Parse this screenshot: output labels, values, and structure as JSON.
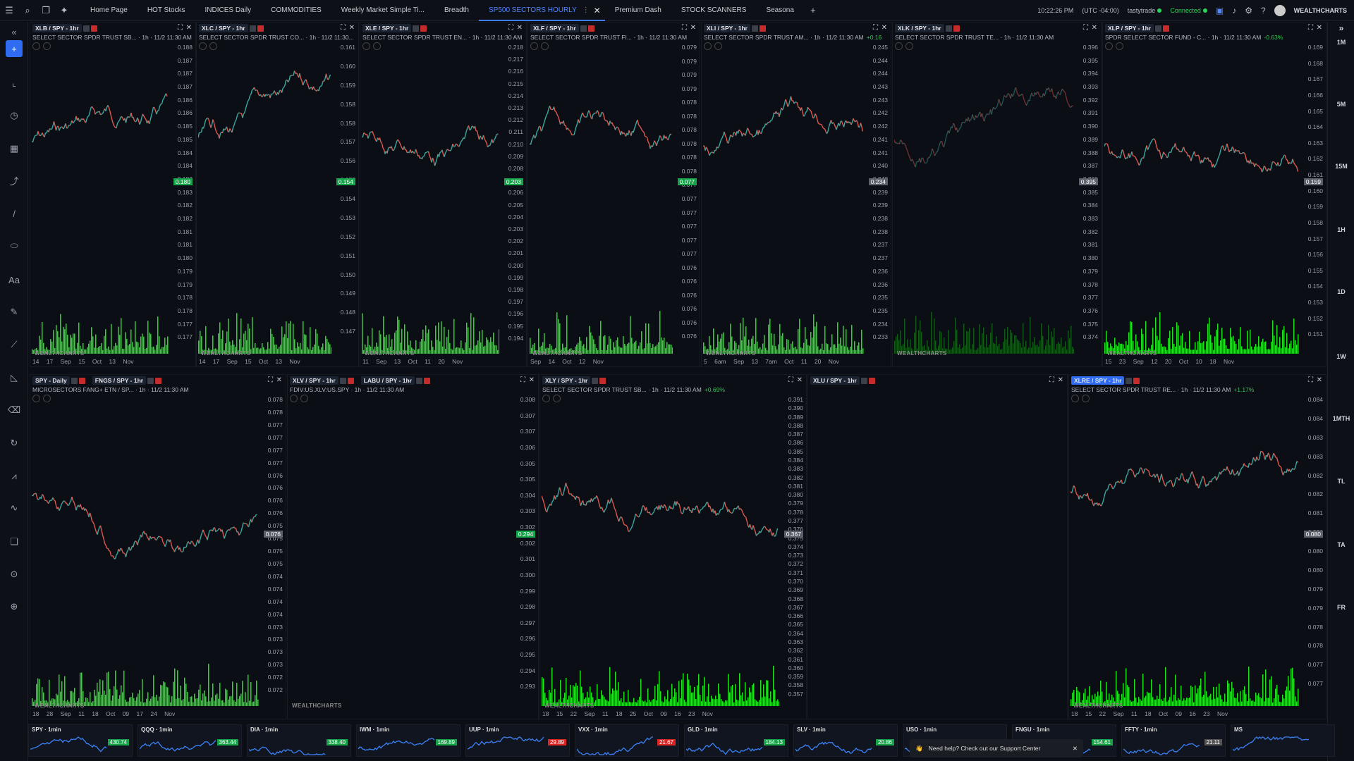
{
  "topbar": {
    "tabs": [
      "Home Page",
      "HOT Stocks",
      "INDICES Daily",
      "COMMODITIES",
      "Weekly Market Simple Ti...",
      "Breadth",
      "SP500 SECTORS HOURLY",
      "Premium Dash",
      "STOCK SCANNERS",
      "Seasona"
    ],
    "active_tab": "SP500 SECTORS HOURLY",
    "clock": "10:22:26 PM",
    "timezone": "(UTC -04:00)",
    "broker": "tastytrade",
    "status": "Connected",
    "brand": "WEALTHCHARTS"
  },
  "right_intervals": [
    "1M",
    "5M",
    "15M",
    "1H",
    "1D",
    "1W",
    "1MTH",
    "TL",
    "TA",
    "FR"
  ],
  "panels": [
    {
      "symbol": "XLB / SPY - 1hr",
      "desc": "SELECT SECTOR SPDR TRUST SB... · 1h · 11/2 11:30 AM",
      "change": "",
      "price": "0.180",
      "price_color": "green",
      "ticks": [
        "0.188",
        "0.187",
        "0.187",
        "0.187",
        "0.186",
        "0.186",
        "0.185",
        "0.185",
        "0.184",
        "0.184",
        "0.183",
        "0.183",
        "0.182",
        "0.182",
        "0.181",
        "0.181",
        "0.180",
        "0.179",
        "0.179",
        "0.178",
        "0.178",
        "0.177",
        "0.177"
      ],
      "xaxis": "14 17 Sep 15 Oct 13 Nov",
      "color": "#ef5350"
    },
    {
      "symbol": "XLC / SPY - 1hr",
      "desc": "SELECT SECTOR SPDR TRUST CO... · 1h · 11/2 11:30...",
      "change": "",
      "price": "0.154",
      "price_color": "green",
      "ticks": [
        "0.161",
        "0.160",
        "0.159",
        "0.158",
        "0.158",
        "0.157",
        "0.156",
        "0.155",
        "0.154",
        "0.153",
        "0.152",
        "0.151",
        "0.150",
        "0.149",
        "0.148",
        "0.147"
      ],
      "xaxis": "14 17 Sep 15 Oct 13 Nov",
      "color": "#ef5350"
    },
    {
      "symbol": "XLE / SPY - 1hr",
      "desc": "SELECT SECTOR SPDR TRUST EN... · 1h · 11/2 11:30 AM",
      "change": "",
      "price": "0.203",
      "price_color": "green",
      "ticks": [
        "0.218",
        "0.217",
        "0.216",
        "0.215",
        "0.214",
        "0.213",
        "0.212",
        "0.211",
        "0.210",
        "0.209",
        "0.208",
        "0.207",
        "0.206",
        "0.205",
        "0.204",
        "0.203",
        "0.202",
        "0.201",
        "0.200",
        "0.199",
        "0.198",
        "0.197",
        "0.196",
        "0.195",
        "0.194"
      ],
      "xaxis": "11 Sep 13 Oct 11 20 Nov",
      "color": "#ef5350"
    },
    {
      "symbol": "XLF / SPY - 1hr",
      "desc": "SELECT SECTOR SPDR TRUST FI... · 1h · 11/2 11:30 AM",
      "change": "",
      "price": "0.077",
      "price_color": "green",
      "ticks": [
        "0.079",
        "0.079",
        "0.079",
        "0.079",
        "0.078",
        "0.078",
        "0.078",
        "0.078",
        "0.078",
        "0.078",
        "0.077",
        "0.077",
        "0.077",
        "0.077",
        "0.077",
        "0.077",
        "0.076",
        "0.076",
        "0.076",
        "0.076",
        "0.076",
        "0.076"
      ],
      "xaxis": "Sep 14 Oct 12 Nov",
      "color": "#ef5350"
    },
    {
      "symbol": "XLI / SPY - 1hr",
      "desc": "SELECT SECTOR SPDR TRUST AM... · 1h · 11/2 11:30 AM",
      "change": "+0.16",
      "price": "0.234",
      "price_color": "gray",
      "ticks": [
        "0.245",
        "0.244",
        "0.244",
        "0.243",
        "0.243",
        "0.242",
        "0.242",
        "0.241",
        "0.241",
        "0.240",
        "0.240",
        "0.239",
        "0.239",
        "0.238",
        "0.238",
        "0.237",
        "0.237",
        "0.236",
        "0.236",
        "0.235",
        "0.235",
        "0.234",
        "0.233"
      ],
      "xaxis": "5 6am Sep 13 7am Oct 11 20 Nov",
      "color": "#ef5350"
    },
    {
      "symbol": "XLK / SPY - 1hr",
      "desc": "SELECT SECTOR SPDR TRUST TE... · 1h · 11/2 11:30 AM",
      "change": "",
      "price": "0.395",
      "price_color": "gray",
      "ticks": [
        "0.396",
        "0.395",
        "0.394",
        "0.393",
        "0.392",
        "0.391",
        "0.390",
        "0.389",
        "0.388",
        "0.387",
        "0.386",
        "0.385",
        "0.384",
        "0.383",
        "0.382",
        "0.381",
        "0.380",
        "0.379",
        "0.378",
        "0.377",
        "0.376",
        "0.375",
        "0.374"
      ],
      "xaxis": "",
      "color": "#ef5350"
    },
    {
      "symbol": "XLP / SPY - 1hr",
      "desc": "SPDR SELECT SECTOR FUND - C... · 1h · 11/2 11:30 AM",
      "change": "-0.63%",
      "price": "0.159",
      "price_color": "gray",
      "ticks": [
        "0.169",
        "0.168",
        "0.167",
        "0.166",
        "0.165",
        "0.164",
        "0.163",
        "0.162",
        "0.161",
        "0.160",
        "0.159",
        "0.158",
        "0.157",
        "0.156",
        "0.155",
        "0.154",
        "0.153",
        "0.152",
        "0.151"
      ],
      "xaxis": "15 23 Sep 12 20 Oct 10 18 Nov",
      "color": "#ef5350"
    },
    {
      "symbol": "SPY - Daily",
      "symbol2": "FNGS / SPY - 1hr",
      "desc": "MICROSECTORS FANG+ ETN / SP... · 1h · 11/2 11:30 AM",
      "change": "",
      "price": "0.076",
      "price_color": "gray",
      "ticks": [
        "0.078",
        "0.078",
        "0.077",
        "0.077",
        "0.077",
        "0.077",
        "0.076",
        "0.076",
        "0.076",
        "0.076",
        "0.075",
        "0.075",
        "0.075",
        "0.075",
        "0.074",
        "0.074",
        "0.074",
        "0.074",
        "0.073",
        "0.073",
        "0.073",
        "0.073",
        "0.072",
        "0.072"
      ],
      "xaxis": "18 28 Sep 11 18 Oct 09 17 24 Nov",
      "color": "#ef5350"
    },
    {
      "symbol": "XLV / SPY - 1hr",
      "symbol2": "LABU / SPY - 1hr",
      "desc": "FDIV:US.XLV:US.SPY · 1h · 11/2 11:30 AM",
      "change": "",
      "price": "0.294",
      "price_color": "green",
      "ticks": [
        "0.308",
        "0.307",
        "0.307",
        "0.306",
        "0.305",
        "0.305",
        "0.304",
        "0.303",
        "0.302",
        "0.302",
        "0.301",
        "0.300",
        "0.299",
        "0.298",
        "0.297",
        "0.296",
        "0.295",
        "0.294",
        "0.293"
      ],
      "xaxis": "",
      "color": "#ef5350"
    },
    {
      "symbol": "XLY / SPY - 1hr",
      "desc": "SELECT SECTOR SPDR TRUST SB... · 1h · 11/2 11:30 AM",
      "change": "+0.69%",
      "price": "0.367",
      "price_color": "gray",
      "ticks": [
        "0.391",
        "0.390",
        "0.389",
        "0.388",
        "0.387",
        "0.386",
        "0.385",
        "0.384",
        "0.383",
        "0.382",
        "0.381",
        "0.380",
        "0.379",
        "0.378",
        "0.377",
        "0.376",
        "0.375",
        "0.374",
        "0.373",
        "0.372",
        "0.371",
        "0.370",
        "0.369",
        "0.368",
        "0.367",
        "0.366",
        "0.365",
        "0.364",
        "0.363",
        "0.362",
        "0.361",
        "0.360",
        "0.359",
        "0.358",
        "0.357"
      ],
      "xaxis": "18 15 22 Sep 11 18 25 Oct 09 16 23 Nov",
      "color": "#ef5350"
    },
    {
      "symbol": "XLU / SPY - 1hr",
      "desc": "",
      "change": "",
      "price": "",
      "price_color": "gray",
      "ticks": [],
      "xaxis": "",
      "color": "#ef5350"
    },
    {
      "symbol": "XLRE / SPY - 1hr",
      "desc": "SELECT SECTOR SPDR TRUST RE... · 1h · 11/2 11:30 AM",
      "change": "+1.17%",
      "price": "0.080",
      "price_color": "gray",
      "ticks": [
        "0.084",
        "0.084",
        "0.083",
        "0.083",
        "0.082",
        "0.082",
        "0.081",
        "0.081",
        "0.080",
        "0.080",
        "0.079",
        "0.079",
        "0.078",
        "0.078",
        "0.077",
        "0.077"
      ],
      "xaxis": "18 15 22 Sep 11 18 Oct 09 16 23 Nov",
      "color": "#ef5350"
    }
  ],
  "watermark": "WEALTHCHARTS",
  "minis": [
    {
      "label": "SPY · 1min",
      "value": "430.74",
      "color": "green"
    },
    {
      "label": "QQQ · 1min",
      "value": "363.44",
      "color": "green"
    },
    {
      "label": "DIA · 1min",
      "value": "338.40",
      "color": "green"
    },
    {
      "label": "IWM · 1min",
      "value": "169.89",
      "color": "green"
    },
    {
      "label": "UUP · 1min",
      "value": "29.89",
      "color": "red"
    },
    {
      "label": "VXX · 1min",
      "value": "21.67",
      "color": "red"
    },
    {
      "label": "GLD · 1min",
      "value": "184.13",
      "color": "green"
    },
    {
      "label": "SLV · 1min",
      "value": "20.86",
      "color": "green"
    },
    {
      "label": "USO · 1min",
      "value": "",
      "color": "green"
    },
    {
      "label": "FNGU · 1min",
      "value": "154.61",
      "color": "green"
    },
    {
      "label": "FFTY · 1min",
      "value": "21.11",
      "color": "gray"
    },
    {
      "label": "MS",
      "value": "",
      "color": "gray"
    }
  ],
  "support": {
    "text": "Need help? Check out our Support Center"
  }
}
